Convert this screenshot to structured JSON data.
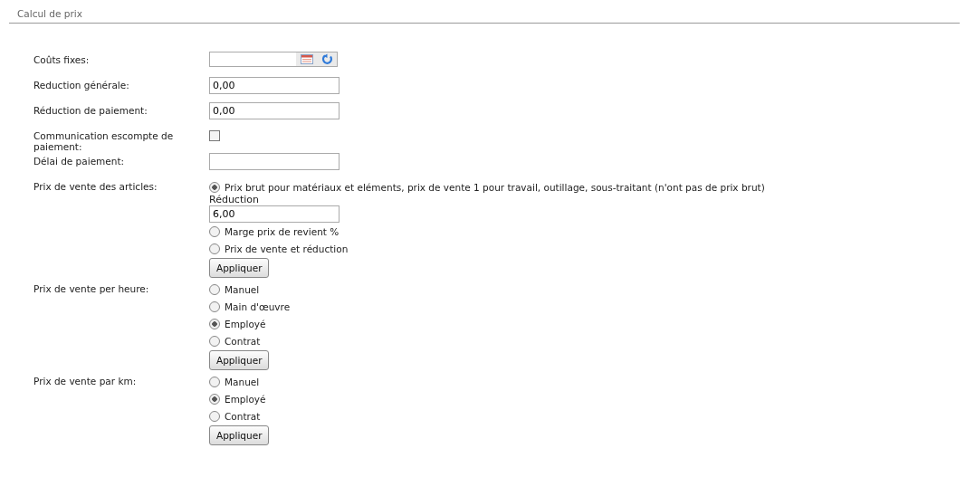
{
  "section": {
    "title": "Calcul de prix"
  },
  "fields": [
    {
      "kind": "picker",
      "label": "Coûts fixes:"
    },
    {
      "kind": "text",
      "label": "Reduction générale:",
      "value": "0,00"
    },
    {
      "kind": "text",
      "label": "Réduction de paiement:",
      "value": "0,00"
    },
    {
      "kind": "checkbox",
      "label": "Communication escompte de paiement:",
      "checked": false
    },
    {
      "kind": "text",
      "label": "Délai de paiement:"
    },
    {
      "kind": "radio",
      "label": "Prix de vente des articles:",
      "options": [
        {
          "label": "Prix brut pour matériaux et eléments, prix de vente 1 pour travail, outillage, sous-traitant (n'ont pas de prix brut)",
          "selected": true,
          "subfield": {
            "label": "Réduction",
            "value": "6,00"
          }
        },
        {
          "label": "Marge prix de revient %",
          "selected": false
        },
        {
          "label": "Prix de vente et réduction",
          "selected": false
        }
      ],
      "button": "Appliquer"
    },
    {
      "kind": "radio",
      "label": "Prix de vente per heure:",
      "options": [
        {
          "label": "Manuel",
          "selected": false
        },
        {
          "label": "Main d'œuvre",
          "selected": false
        },
        {
          "label": "Employé",
          "selected": true
        },
        {
          "label": "Contrat",
          "selected": false
        }
      ],
      "button": "Appliquer"
    },
    {
      "kind": "radio",
      "label": "Prix de vente par km:",
      "options": [
        {
          "label": "Manuel",
          "selected": false
        },
        {
          "label": "Employé",
          "selected": true
        },
        {
          "label": "Contrat",
          "selected": false
        }
      ],
      "button": "Appliquer"
    }
  ]
}
